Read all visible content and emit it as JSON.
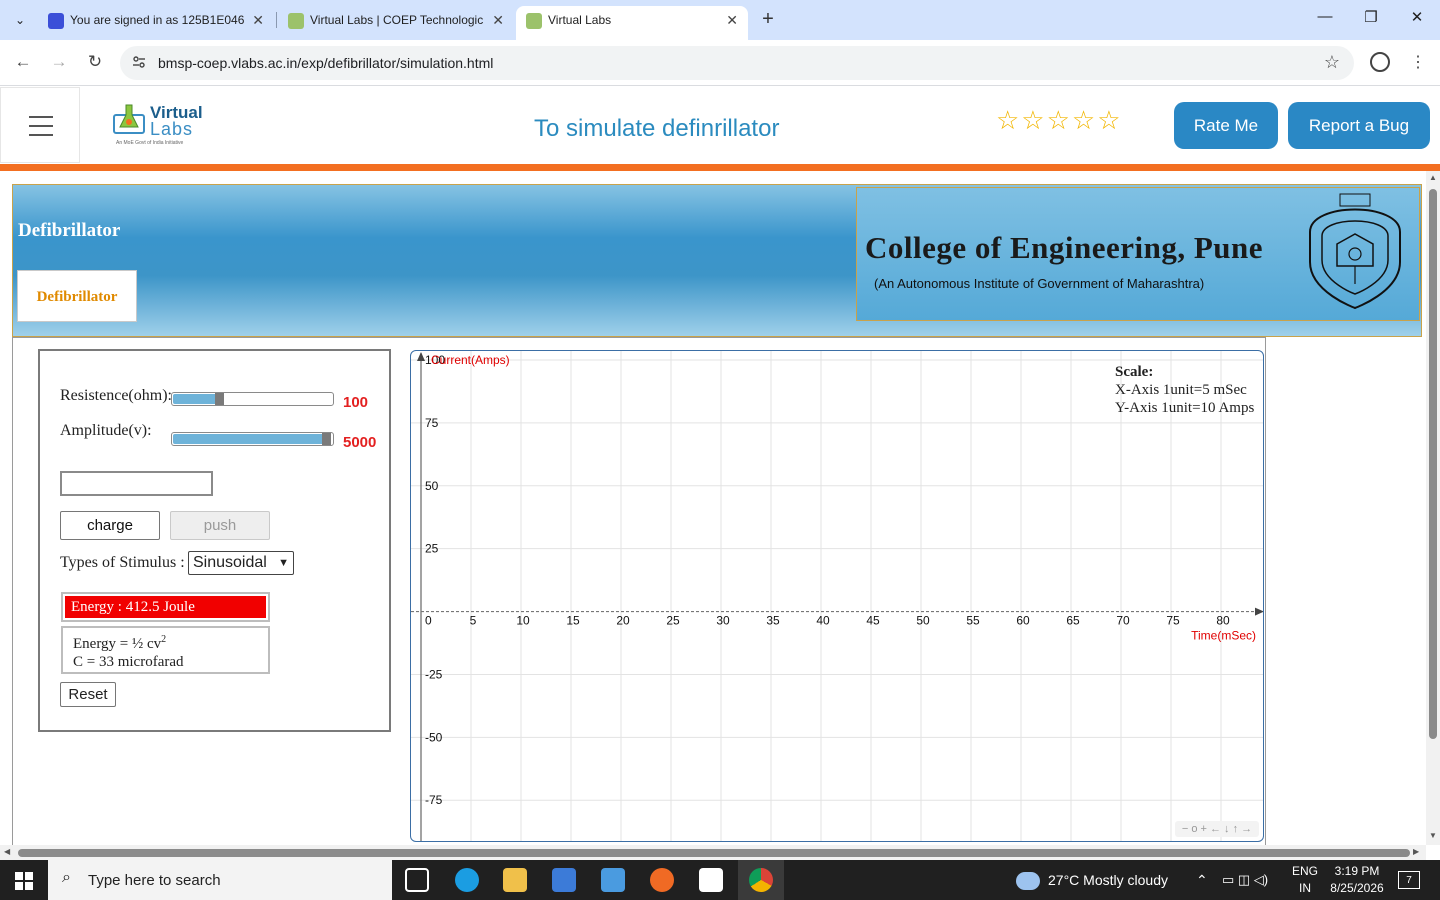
{
  "browser": {
    "tabs": [
      {
        "title": "You are signed in as 125B1E046",
        "active": false
      },
      {
        "title": "Virtual Labs | COEP Technologic",
        "active": false
      },
      {
        "title": "Virtual Labs",
        "active": true
      }
    ],
    "url": "bmsp-coep.vlabs.ac.in/exp/defibrillator/simulation.html"
  },
  "header": {
    "logo_main": "Virtual",
    "logo_sub": "Labs",
    "logo_tag": "An MoE Govt of India Initiative",
    "title": "To simulate definrillator",
    "stars": "☆☆☆☆☆",
    "rate_label": "Rate Me",
    "bug_label": "Report a Bug"
  },
  "banner": {
    "title": "Defibrillator",
    "tab_label": "Defibrillator",
    "college_name": "College of Engineering, Pune",
    "college_sub": "(An Autonomous Institute of Government of Maharashtra)"
  },
  "controls": {
    "resistance_label": "Resistence(ohm):",
    "resistance_value": "100",
    "resistance_fraction": 0.3,
    "amplitude_label": "Amplitude(v):",
    "amplitude_value": "5000",
    "amplitude_fraction": 1.0,
    "charge_label": "charge",
    "push_label": "push",
    "stimulus_label": "Types of Stimulus :",
    "stimulus_selected": "Sinusoidal",
    "energy_text": "Energy : 412.5 Joule",
    "formula_line1": "Energy = ½ cv",
    "formula_sup": "2",
    "formula_line2": "C = 33 microfarad",
    "reset_label": "Reset"
  },
  "graph": {
    "y_axis_title": "Current(Amps)",
    "x_axis_title": "Time(mSec)",
    "scale_title": "Scale:",
    "scale_x": "X-Axis 1unit=5 mSec",
    "scale_y": "Y-Axis 1unit=10 Amps",
    "nav_glyphs": "− o + ← ↓ ↑ →"
  },
  "chart_data": {
    "type": "line",
    "title": "",
    "xlabel": "Time(mSec)",
    "ylabel": "Current(Amps)",
    "xlim": [
      0,
      84
    ],
    "ylim": [
      -92,
      100
    ],
    "x_ticks": [
      0,
      5,
      10,
      15,
      20,
      25,
      30,
      35,
      40,
      45,
      50,
      55,
      60,
      65,
      70,
      75,
      80
    ],
    "y_ticks": [
      100,
      75,
      50,
      25,
      -25,
      -50,
      -75
    ],
    "grid": true,
    "series": []
  },
  "taskbar": {
    "search_placeholder": "Type here to search",
    "weather": "27°C  Mostly cloudy",
    "lang_top": "ENG",
    "lang_bottom": "IN",
    "time": "3:19 PM",
    "date": "8/25/2026",
    "notif_count": "7"
  }
}
